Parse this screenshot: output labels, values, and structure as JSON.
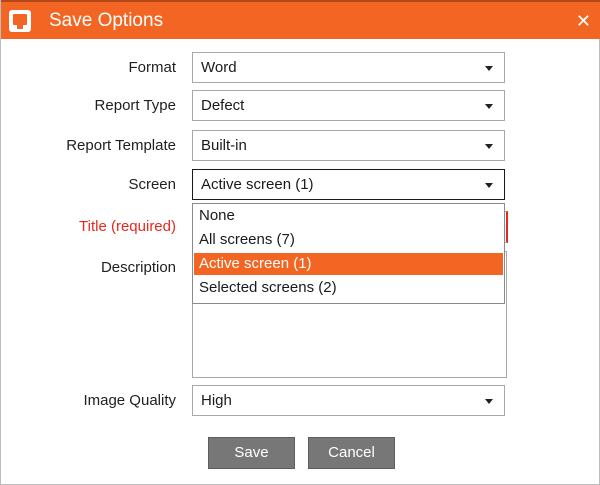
{
  "dialog": {
    "title": "Save Options",
    "close_glyph": "✕",
    "icon": "app-logo-icon",
    "accent_color": "#f26522"
  },
  "fields": {
    "format": {
      "label": "Format",
      "value": "Word"
    },
    "report_type": {
      "label": "Report Type",
      "value": "Defect"
    },
    "report_template": {
      "label": "Report Template",
      "value": "Built-in"
    },
    "screen": {
      "label": "Screen",
      "value": "Active screen (1)"
    },
    "title": {
      "label": "Title (required)",
      "value": ""
    },
    "description": {
      "label": "Description",
      "value": ""
    },
    "image_quality": {
      "label": "Image Quality",
      "value": "High"
    }
  },
  "screen_dropdown": {
    "options": [
      "None",
      "All screens (7)",
      "Active screen (1)",
      "Selected screens (2)"
    ],
    "selected": "Active screen (1)"
  },
  "buttons": {
    "save": "Save",
    "cancel": "Cancel"
  }
}
